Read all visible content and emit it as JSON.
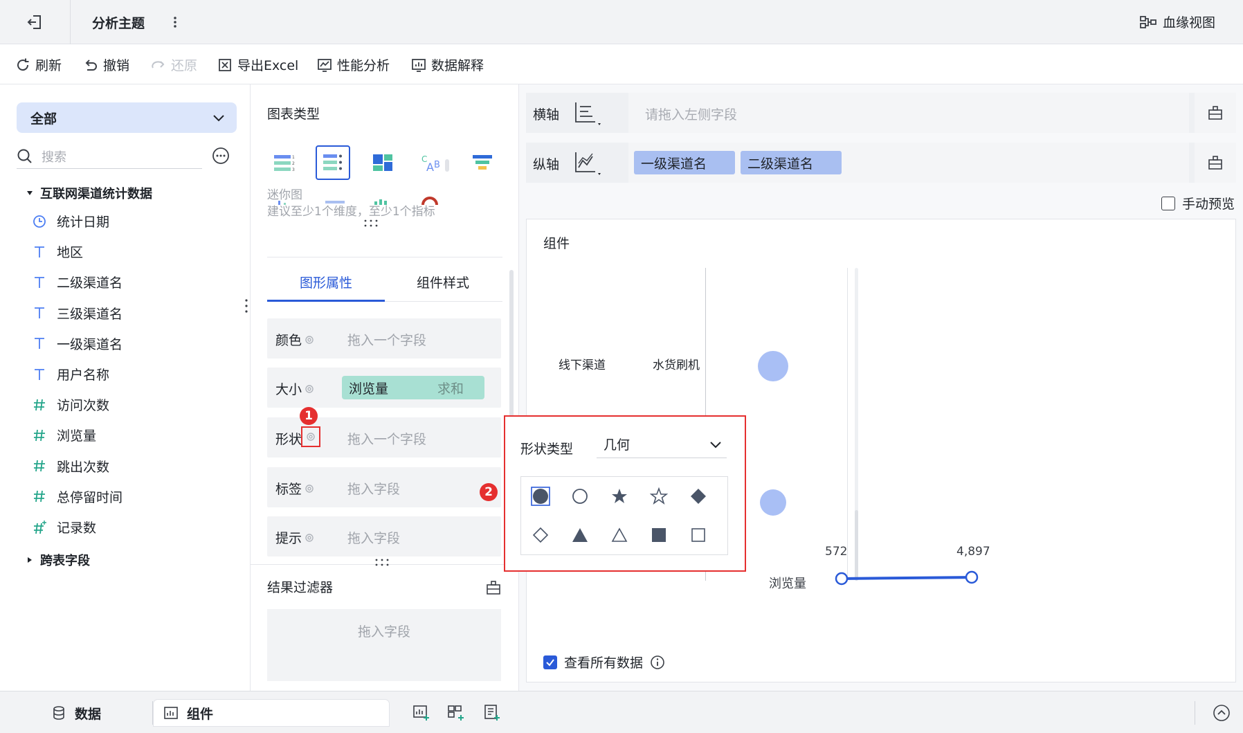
{
  "topbar": {
    "title": "分析主题",
    "lineage": "血缘视图"
  },
  "toolbar": {
    "refresh": "刷新",
    "undo": "撤销",
    "redo": "还原",
    "export": "导出Excel",
    "perf": "性能分析",
    "explain": "数据解释"
  },
  "left": {
    "dropdown": "全部",
    "search_placeholder": "搜索",
    "dataset": "互联网渠道统计数据",
    "fields": [
      {
        "type": "date",
        "label": "统计日期"
      },
      {
        "type": "text",
        "label": "地区"
      },
      {
        "type": "text",
        "label": "二级渠道名"
      },
      {
        "type": "text",
        "label": "三级渠道名"
      },
      {
        "type": "text",
        "label": "一级渠道名"
      },
      {
        "type": "text",
        "label": "用户名称"
      },
      {
        "type": "num",
        "label": "访问次数"
      },
      {
        "type": "num",
        "label": "浏览量"
      },
      {
        "type": "num",
        "label": "跳出次数"
      },
      {
        "type": "num",
        "label": "总停留时间"
      },
      {
        "type": "num-calc",
        "label": "记录数"
      }
    ],
    "cross_table": "跨表字段"
  },
  "mid": {
    "chart_type_title": "图表类型",
    "mini_name": "迷你图",
    "mini_tip": "建议至少1个维度，至少1个指标",
    "tab_graph": "图形属性",
    "tab_style": "组件样式",
    "color_label": "颜色",
    "color_ph": "拖入一个字段",
    "size_label": "大小",
    "size_field": "浏览量",
    "size_agg": "求和",
    "shape_label": "形状",
    "shape_ph": "拖入一个字段",
    "tag_label": "标签",
    "tag_ph": "拖入字段",
    "hint_label": "提示",
    "hint_ph": "拖入字段",
    "filter_title": "结果过滤器",
    "filter_ph": "拖入字段",
    "badge1": "1",
    "badge2": "2"
  },
  "right": {
    "x_label": "横轴",
    "x_ph": "请拖入左侧字段",
    "y_label": "纵轴",
    "y_pill1": "一级渠道名",
    "y_pill2": "二级渠道名",
    "manual_preview": "手动预览",
    "canvas_title": "组件",
    "row1_a": "线下渠道",
    "row1_b": "水货刷机",
    "legend_label": "浏览量",
    "legend_min": "572",
    "legend_max": "4,897",
    "view_all": "查看所有数据",
    "popup_label": "形状类型",
    "popup_value": "几何"
  },
  "bottom": {
    "tab_data": "数据",
    "tab_component": "组件"
  },
  "colors": {
    "accent": "#2a5ad8",
    "badge": "#e52f2f",
    "bubble": "#a9bff5",
    "pill_y": "#a9bff1",
    "pill_size": "#a8e0d3"
  }
}
